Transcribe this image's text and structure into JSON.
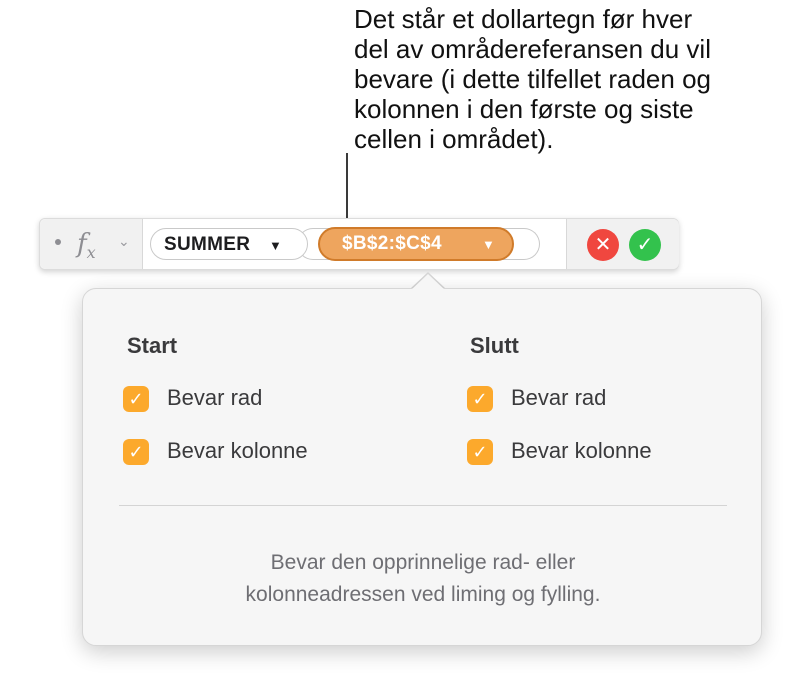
{
  "callout": {
    "lines": [
      "Det står et dollartegn før hver",
      "del av områdereferansen du vil",
      "bevare (i dette tilfellet raden og",
      "kolonnen i den første og siste",
      "cellen i området)."
    ]
  },
  "formula_bar": {
    "fx_icon": "function-fx-icon",
    "function_token": "SUMMER",
    "argument_token": "$B$2:$C$4",
    "dropdown_caret": "▼",
    "cancel_icon": "✕",
    "accept_icon": "✓",
    "colors": {
      "argument_fill": "#eea55e",
      "argument_border": "#d07b2a",
      "cancel": "#f0473f",
      "accept": "#33c24d"
    }
  },
  "popover": {
    "start": {
      "heading": "Start",
      "options": [
        {
          "label": "Bevar rad",
          "checked": true
        },
        {
          "label": "Bevar kolonne",
          "checked": true
        }
      ]
    },
    "end": {
      "heading": "Slutt",
      "options": [
        {
          "label": "Bevar rad",
          "checked": true
        },
        {
          "label": "Bevar kolonne",
          "checked": true
        }
      ]
    },
    "checkmark": "✓",
    "checkbox_color": "#fca92c",
    "hint_lines": [
      "Bevar den opprinnelige rad- eller",
      "kolonneadressen ved liming og fylling."
    ]
  }
}
